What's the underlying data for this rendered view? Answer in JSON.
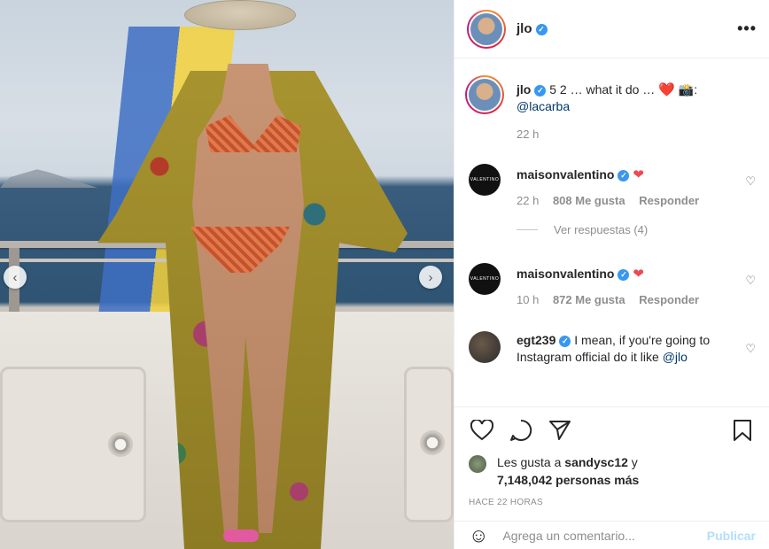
{
  "post": {
    "username": "jlo",
    "more_label": "•••",
    "prev_label": "‹",
    "next_label": "›"
  },
  "caption": {
    "username": "jlo",
    "text": " 5 2 … what it do …",
    "emoji_heart": "❤️",
    "emoji_camera": "📸",
    "colon": ":",
    "mention": "@lacarba",
    "time": "22 h"
  },
  "comments": [
    {
      "username": "maisonvalentino",
      "text": "❤",
      "time": "22 h",
      "likes": "808 Me gusta",
      "reply": "Responder",
      "avatar_text": "VALENTINO",
      "view_replies": "Ver respuestas (4)"
    },
    {
      "username": "maisonvalentino",
      "text": "❤",
      "time": "10 h",
      "likes": "872 Me gusta",
      "reply": "Responder",
      "avatar_text": "VALENTINO"
    },
    {
      "username": "egt239",
      "text": " I mean, if you're going to Instagram official do it like ",
      "mention": "@jlo"
    }
  ],
  "likes": {
    "prefix": "Les gusta a ",
    "user": "sandysc12",
    "middle": " y",
    "count": "7,148,042 personas más"
  },
  "timestamp": "HACE 22 HORAS",
  "add_comment": {
    "emoji": "☺",
    "placeholder": "Agrega un comentario...",
    "post_label": "Publicar"
  },
  "icons": [
    "heart-icon",
    "comment-icon",
    "share-icon",
    "bookmark-icon",
    "more-icon",
    "verified-icon",
    "emoji-icon"
  ],
  "colors": {
    "accent": "#3897f0",
    "mention": "#00376b",
    "heart": "#ed4956",
    "publish": "#b2dffc"
  }
}
